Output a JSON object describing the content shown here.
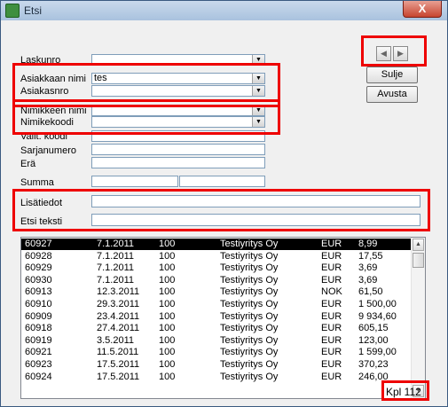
{
  "window": {
    "title": "Etsi",
    "close_glyph": "X"
  },
  "form": {
    "laskunro": {
      "label": "Laskunro",
      "value": ""
    },
    "asiakkaan_nimi": {
      "label": "Asiakkaan nimi",
      "value": "tes"
    },
    "asiakasnro": {
      "label": "Asiakasnro",
      "value": ""
    },
    "nimikkeen_nimi": {
      "label": "Nimikkeen nimi",
      "value": ""
    },
    "nimikekoodi": {
      "label": "Nimikekoodi",
      "value": ""
    },
    "valit_koodi": {
      "label": "Valit. koodi",
      "value": ""
    },
    "sarjanumero": {
      "label": "Sarjanumero",
      "value": ""
    },
    "era": {
      "label": "Erä",
      "value": ""
    },
    "summa": {
      "label": "Summa",
      "value_from": "",
      "value_to": ""
    },
    "lisatiedot": {
      "label": "Lisätiedot",
      "value": ""
    },
    "etsi_teksti": {
      "label": "Etsi teksti",
      "value": ""
    }
  },
  "buttons": {
    "prev_glyph": "◀",
    "next_glyph": "▶",
    "sulje": "Sulje",
    "avusta": "Avusta"
  },
  "list": {
    "rows": [
      [
        "60927",
        "7.1.2011",
        "100",
        "Testiyritys Oy",
        "EUR",
        "8,99"
      ],
      [
        "60928",
        "7.1.2011",
        "100",
        "Testiyritys Oy",
        "EUR",
        "17,55"
      ],
      [
        "60929",
        "7.1.2011",
        "100",
        "Testiyritys Oy",
        "EUR",
        "3,69"
      ],
      [
        "60930",
        "7.1.2011",
        "100",
        "Testiyritys Oy",
        "EUR",
        "3,69"
      ],
      [
        "60913",
        "12.3.2011",
        "100",
        "Testiyritys Oy",
        "NOK",
        "61,50"
      ],
      [
        "60910",
        "29.3.2011",
        "100",
        "Testiyritys Oy",
        "EUR",
        "1 500,00"
      ],
      [
        "60909",
        "23.4.2011",
        "100",
        "Testiyritys Oy",
        "EUR",
        "9 934,60"
      ],
      [
        "60918",
        "27.4.2011",
        "100",
        "Testiyritys Oy",
        "EUR",
        "605,15"
      ],
      [
        "60919",
        "3.5.2011",
        "100",
        "Testiyritys Oy",
        "EUR",
        "123,00"
      ],
      [
        "60921",
        "11.5.2011",
        "100",
        "Testiyritys Oy",
        "EUR",
        "1 599,00"
      ],
      [
        "60923",
        "17.5.2011",
        "100",
        "Testiyritys Oy",
        "EUR",
        "370,23"
      ],
      [
        "60924",
        "17.5.2011",
        "100",
        "Testiyritys Oy",
        "EUR",
        "246,00"
      ]
    ],
    "selected_index": 0
  },
  "footer": {
    "count": "Kpl  112"
  },
  "colors": {
    "highlight": "#ee0000",
    "selection": "#000000"
  }
}
